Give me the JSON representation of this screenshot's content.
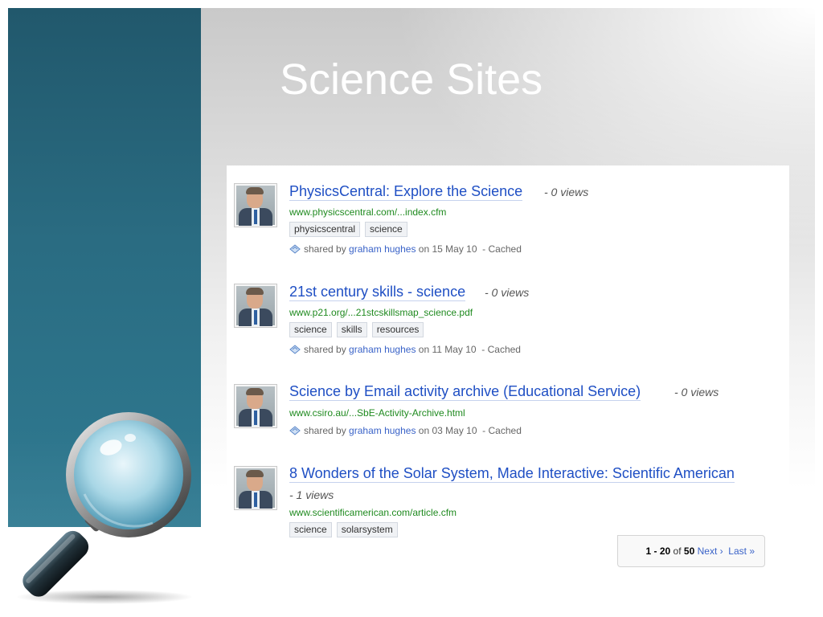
{
  "slide": {
    "title": "Science Sites"
  },
  "results": [
    {
      "title": "PhysicsCentral: Explore the Science",
      "views": "- 0 views",
      "url": "www.physicscentral.com/...index.cfm",
      "tags": [
        "physicscentral",
        "science"
      ],
      "shared_prefix": "shared by",
      "user": "graham hughes",
      "date_text": "on 15 May 10",
      "cached": "- Cached"
    },
    {
      "title": "21st century skills - science",
      "views": "- 0 views",
      "url": "www.p21.org/...21stcskillsmap_science.pdf",
      "tags": [
        "science",
        "skills",
        "resources"
      ],
      "shared_prefix": "shared by",
      "user": "graham hughes",
      "date_text": "on 11 May 10",
      "cached": "- Cached"
    },
    {
      "title": "Science by Email activity archive (Educational Service)",
      "views": "- 0 views",
      "url": "www.csiro.au/...SbE-Activity-Archive.html",
      "tags": [],
      "shared_prefix": "shared by",
      "user": "graham hughes",
      "date_text": "on 03 May 10",
      "cached": "- Cached"
    },
    {
      "title": "8 Wonders of the Solar System, Made Interactive: Scientific American",
      "views": "- 1 views",
      "url": "www.scientificamerican.com/article.cfm",
      "tags": [
        "science",
        "solarsystem"
      ]
    }
  ],
  "pager": {
    "range": "1 - 20",
    "of": "of",
    "total": "50",
    "next": "Next ›",
    "last": "Last »"
  },
  "colors": {
    "panel": "#2a6c82",
    "link": "#1f4fc4",
    "url": "#1f8a1f"
  }
}
